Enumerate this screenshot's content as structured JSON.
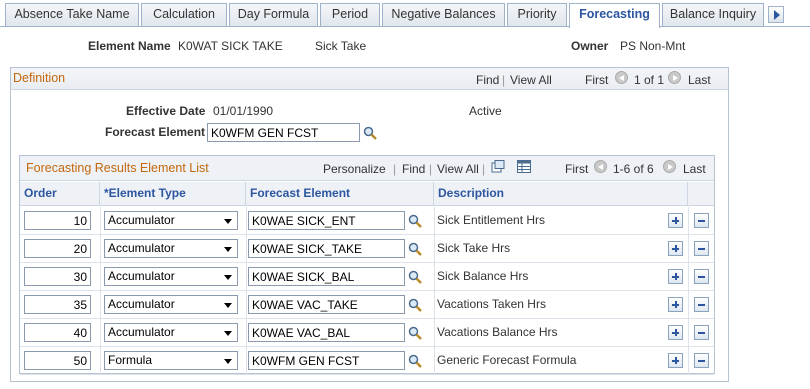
{
  "tabs": [
    {
      "label": "Absence Take Name",
      "active": false
    },
    {
      "label": "Calculation",
      "active": false
    },
    {
      "label": "Day Formula",
      "active": false
    },
    {
      "label": "Period",
      "active": false
    },
    {
      "label": "Negative Balances",
      "active": false
    },
    {
      "label": "Priority",
      "active": false
    },
    {
      "label": "Forecasting",
      "active": true
    },
    {
      "label": "Balance Inquiry",
      "active": false
    }
  ],
  "header": {
    "element_name_label": "Element Name",
    "element_name_value": "K0WAT SICK TAKE",
    "element_desc": "Sick Take",
    "owner_label": "Owner",
    "owner_value": "PS Non-Mnt"
  },
  "definition": {
    "title": "Definition",
    "find": "Find",
    "sep": "|",
    "view_all": "View All",
    "first": "First",
    "range": "1 of 1",
    "last": "Last",
    "effective_date_label": "Effective Date",
    "effective_date_value": "01/01/1990",
    "status": "Active",
    "forecast_element_label": "Forecast Element",
    "forecast_element_value": "K0WFM GEN FCST"
  },
  "grid": {
    "title": "Forecasting Results Element List",
    "personalize": "Personalize",
    "find": "Find",
    "view_all": "View All",
    "first": "First",
    "range": "1-6 of 6",
    "last": "Last",
    "columns": [
      "Order",
      "*Element Type",
      "Forecast Element",
      "Description"
    ],
    "rows": [
      {
        "order": "10",
        "type": "Accumulator",
        "element": "K0WAE SICK_ENT",
        "desc": "Sick Entitlement Hrs"
      },
      {
        "order": "20",
        "type": "Accumulator",
        "element": "K0WAE SICK_TAKE",
        "desc": "Sick Take Hrs"
      },
      {
        "order": "30",
        "type": "Accumulator",
        "element": "K0WAE SICK_BAL",
        "desc": "Sick Balance Hrs"
      },
      {
        "order": "35",
        "type": "Accumulator",
        "element": "K0WAE VAC_TAKE",
        "desc": "Vacations Taken Hrs"
      },
      {
        "order": "40",
        "type": "Accumulator",
        "element": "K0WAE VAC_BAL",
        "desc": "Vacations Balance Hrs"
      },
      {
        "order": "50",
        "type": "Formula",
        "element": "K0WFM GEN FCST",
        "desc": "Generic Forecast Formula"
      }
    ]
  }
}
